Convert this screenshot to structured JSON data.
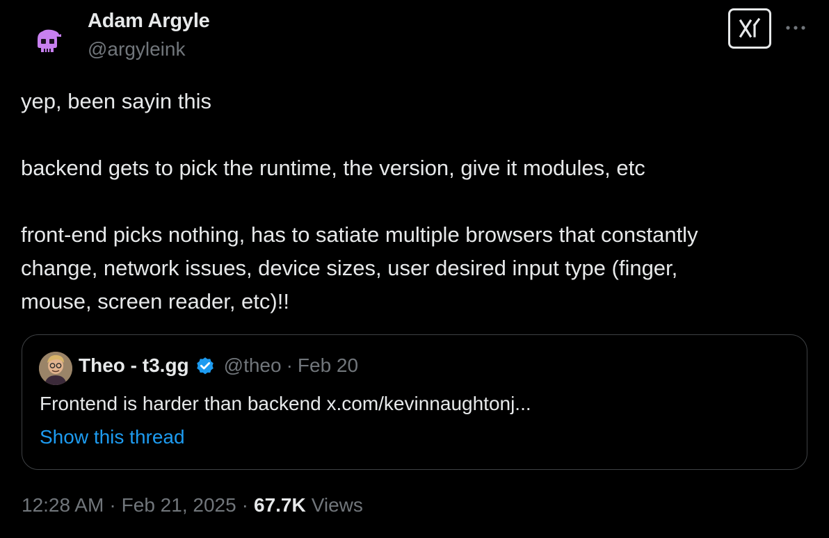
{
  "author": {
    "name": "Adam Argyle",
    "handle": "@argyleink"
  },
  "tweet": {
    "lines": [
      "yep, been sayin this",
      "backend gets to pick the runtime, the version, give it modules, etc",
      "front-end picks nothing, has to satiate multiple browsers that constantly",
      "change, network issues, device sizes, user desired input type (finger,",
      "mouse, screen reader, etc)!!"
    ]
  },
  "quote": {
    "name": "Theo - t3.gg",
    "handle": "@theo",
    "separator": "·",
    "date": "Feb 20",
    "text": "Frontend is harder than backend x.com/kevinnaughtonj...",
    "show_thread": "Show this thread"
  },
  "footer": {
    "time": "12:28 AM",
    "sep1": "·",
    "date": "Feb 21, 2025",
    "sep2": "·",
    "views_count": "67.7K",
    "views_label": "Views"
  },
  "icons": {
    "avatar": "skull-avatar-icon",
    "grok": "grok-icon",
    "more": "more-icon",
    "verified": "verified-badge-icon"
  },
  "colors": {
    "background": "#000000",
    "text": "#e7e9ea",
    "muted": "#71767b",
    "link": "#1d9bf0",
    "avatar_accent": "#c880f0"
  }
}
